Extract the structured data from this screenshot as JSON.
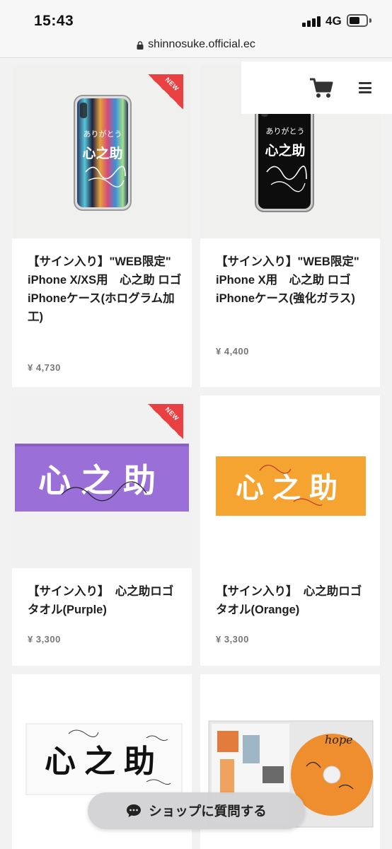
{
  "status": {
    "time": "15:43",
    "network": "4G"
  },
  "browser": {
    "url": "shinnosuke.official.ec"
  },
  "products": [
    {
      "title": "【サイン入り】\"WEB限定\"　iPhone X/XS用　心之助 ロゴiPhoneケース(ホログラム加工)",
      "price": "¥ 4,730",
      "badge": "NEW",
      "image": "phone-case-hologram"
    },
    {
      "title": "【サイン入り】\"WEB限定\"　iPhone X用　心之助 ロゴiPhoneケース(強化ガラス)",
      "price": "¥ 4,400",
      "image": "phone-case-glass"
    },
    {
      "title": "【サイン入り】　心之助ロゴタオル(Purple)",
      "price": "¥ 3,300",
      "badge": "NEW",
      "image": "towel-purple"
    },
    {
      "title": "【サイン入り】　心之助ロゴタオル(Orange)",
      "price": "¥ 3,300",
      "image": "towel-orange"
    },
    {
      "image": "towel-white"
    },
    {
      "image": "cd-hope"
    }
  ],
  "product_image_text": {
    "logo": "心之助",
    "arigato": "ありがとう",
    "cd_title": "hope"
  },
  "floating": {
    "ask_label": "ショップに質問する"
  },
  "colors": {
    "badge": "#e94141",
    "price": "#777777",
    "purple": "#9b6fd8",
    "orange": "#f5a431"
  }
}
